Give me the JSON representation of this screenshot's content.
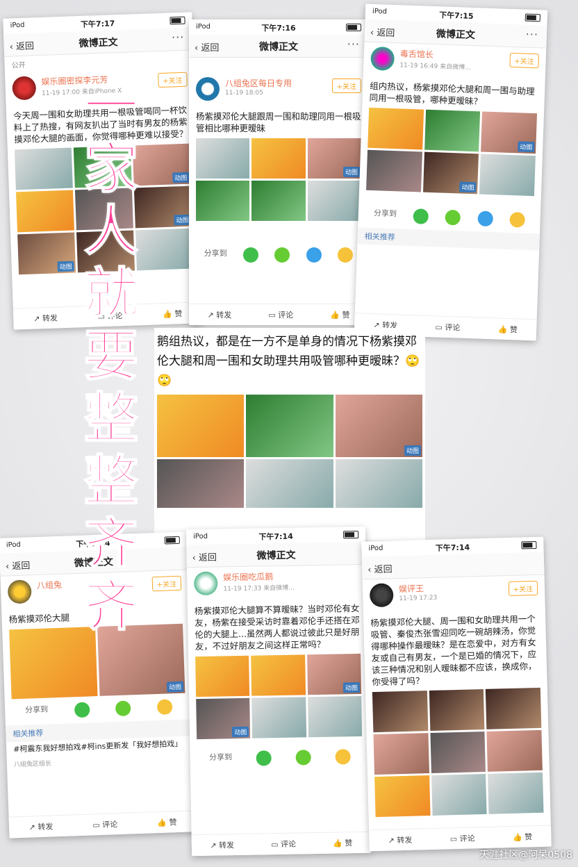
{
  "cards": [
    {
      "time": "下午7:17",
      "device": "iPod",
      "author": "娱乐圈密探李元芳",
      "meta": "11-19 17:00  来自iPhone X",
      "text": "今天周一围和女助理共用一根吸管喝同一杯饮料上了热搜，有网友扒出了当时有男友的杨紫摸邓伦大腿的画面，你觉得哪种更难以接受？",
      "public": "公开"
    },
    {
      "time": "下午7:16",
      "device": "iPod",
      "author": "八组兔区每日专用",
      "meta": "11-19 18:05",
      "text": "杨紫摸邓伦大腿跟周一围和助理同用一根吸管相比哪种更暧昧"
    },
    {
      "time": "下午7:15",
      "device": "iPod",
      "author": "毒舌馆长",
      "meta": "11-19 16:49  来自微博...",
      "text": "组内热议，杨紫摸邓伦大腿和周一围与助理同用一根吸管，哪种更暧昧？",
      "rec": "相关推荐"
    },
    {
      "time": "下午7:14",
      "device": "iPod",
      "author": "八组兔",
      "meta": "",
      "text": "杨紫摸邓伦大腿",
      "rec": "相关推荐",
      "rec_text": "#柯震东我好想拍戏#柯ins更新发「我好想拍戏」",
      "rec_by": "八组兔区组长"
    },
    {
      "time": "下午7:14",
      "device": "iPod",
      "author": "娱乐圈吃瓜鹅",
      "meta": "11-19 17:33  来自微博...",
      "text": "杨紫摸邓伦大腿算不算暧昧？当时邓伦有女友，杨紫在接受采访时靠着邓伦手还搭在邓伦的大腿上...虽然两人都说过彼此只是好朋友，不过好朋友之间这样正常吗？"
    },
    {
      "time": "下午7:14",
      "device": "iPod",
      "author": "娱评王",
      "meta": "11-19 17:23",
      "text": "杨紫摸邓伦大腿、周一围和女助理共用一个吸管、秦俊杰张雪迎同吃一碗胡辣汤，你觉得哪种操作最暧昧？是在恋爱中，对方有女友或自己有男友，一个是已婚的情况下，应该三种情况和别人暧昧都不应该，换成你，你受得了吗？"
    }
  ],
  "common": {
    "nav_back": "返回",
    "nav_title": "微博正文",
    "follow": "+关注",
    "gif": "动图",
    "share": "分享到",
    "forward": "转发",
    "comment": "评论",
    "like": "赞",
    "more": "···"
  },
  "center": {
    "text": "鹅组热议，都是在一方不是单身的情况下杨紫摸邓伦大腿和周一围和女助理共用吸管哪种更暧昧？🙄🙄"
  },
  "overlay": {
    "text": "一家人就要整整齐齐"
  },
  "watermark": {
    "text": "天涯社区@阿呆0508"
  }
}
